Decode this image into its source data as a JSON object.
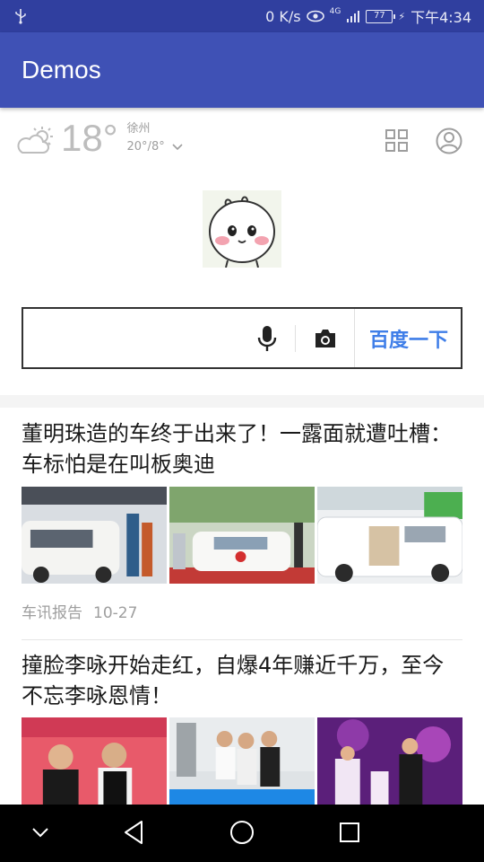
{
  "status_bar": {
    "speed": "0 K/s",
    "network": "4G",
    "battery": "77",
    "time": "下午4:34"
  },
  "app_bar": {
    "title": "Demos"
  },
  "weather": {
    "temperature": "18°",
    "city": "徐州",
    "range": "20°/8°",
    "icon": "partly-sunny-icon"
  },
  "search": {
    "button_label": "百度一下",
    "placeholder": ""
  },
  "news": [
    {
      "title": "董明珠造的车终于出来了！一露面就遭吐槽：车标怕是在叫板奥迪",
      "source": "车讯报告",
      "date": "10-27"
    },
    {
      "title": "撞脸李咏开始走红，自爆4年赚近千万，至今不忘李咏恩情！"
    }
  ],
  "colors": {
    "status_bar": "#303f9f",
    "app_bar": "#3f51b5",
    "search_button": "#3f7ee8"
  }
}
